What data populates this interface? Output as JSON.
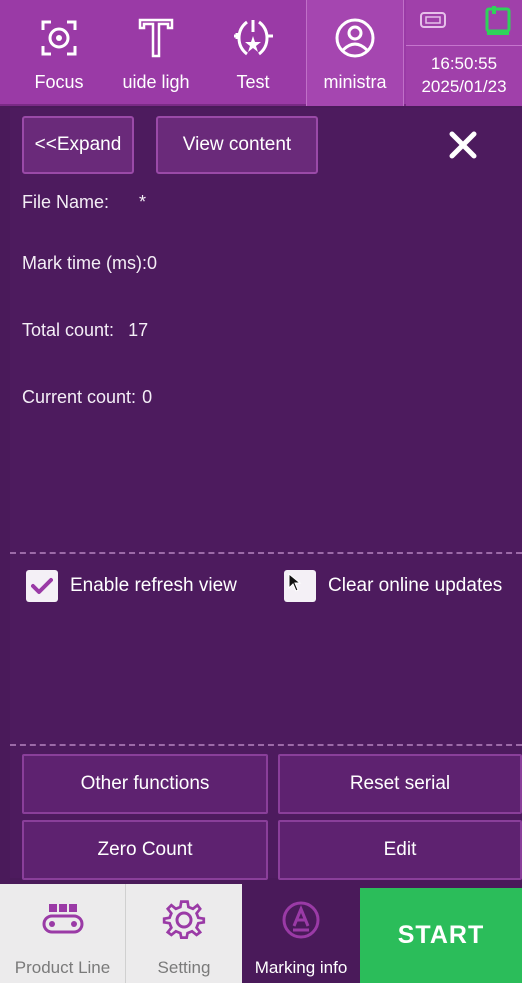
{
  "toolbar": {
    "focus_label": "Focus",
    "guide_label": "uide ligh",
    "test_label": "Test",
    "admin_label": "ministra"
  },
  "status": {
    "time": "16:50:55",
    "date": "2025/01/23"
  },
  "panel": {
    "expand_label": "<<Expand",
    "view_content_label": "View content",
    "file_name_label": "File Name:",
    "file_name_value": "*",
    "mark_time_label": "Mark time (ms):",
    "mark_time_value": "0",
    "total_count_label": "Total count:",
    "total_count_value": "17",
    "current_count_label": "Current count:",
    "current_count_value": "0",
    "enable_refresh_label": "Enable refresh view",
    "enable_refresh_checked": true,
    "clear_online_label": "Clear online updates",
    "clear_online_checked": false
  },
  "actions": {
    "other_functions": "Other functions",
    "reset_serial": "Reset serial",
    "zero_count": "Zero Count",
    "edit": "Edit"
  },
  "bottom_nav": {
    "product_line": "Product Line",
    "setting": "Setting",
    "marking_info": "Marking info",
    "start": "START"
  },
  "colors": {
    "toolbar_bg": "#9a3aa6",
    "panel_bg": "#4d1b5e",
    "start_green": "#2bbd5a",
    "icon_purple": "#9a3aa6",
    "checkbox_mark": "#9a3aa6"
  },
  "icons": {
    "focus": "focus-target-icon",
    "guide": "guide-light-T-icon",
    "test": "laser-test-icon",
    "admin": "user-icon",
    "usb": "usb-icon",
    "network": "network-icon",
    "close": "close-icon",
    "product_line": "conveyor-icon",
    "setting": "gear-icon",
    "marking": "marking-A-icon"
  }
}
